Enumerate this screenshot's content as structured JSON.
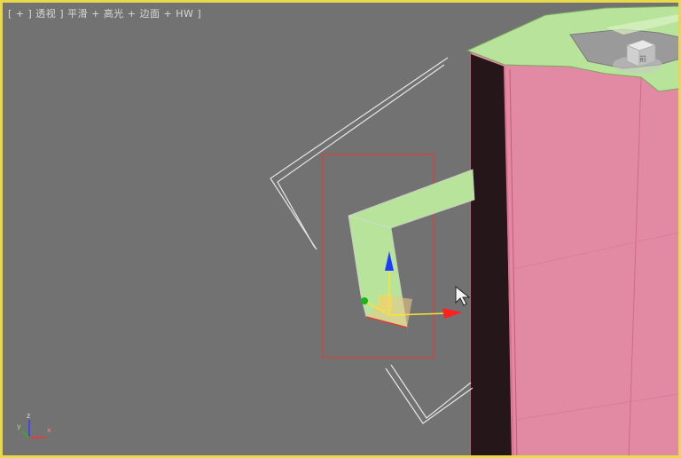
{
  "viewport": {
    "label_text": "[ + ] 透视 ] 平滑 + 高光 + 边面 + HW ]",
    "colors": {
      "frame": "#e8d94a",
      "background": "#727272",
      "wall_fill": "#e28aa3",
      "wall_top": "#b7e39a",
      "selected_shape": "#b7e39a",
      "selection_box": "#e03c3c",
      "gizmo_z": "#1e3cff",
      "gizmo_x": "#ff2020",
      "gizmo_y": "#18b418"
    }
  },
  "nav_cube": {
    "label": "前"
  },
  "axis_tripod": {
    "x": "x",
    "y": "y",
    "z": "z"
  },
  "gizmo": {
    "mode": "move"
  },
  "cursor": {
    "icon": "arrow-cursor-icon"
  }
}
